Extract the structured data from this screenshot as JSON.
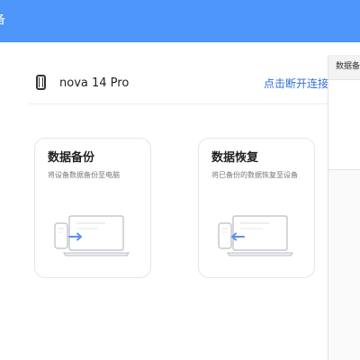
{
  "window": {
    "title": "备"
  },
  "device": {
    "icon": "phone-icon",
    "name": "nova 14 Pro",
    "disconnect_label": "点击断开连接"
  },
  "cards": {
    "backup": {
      "title": "数据备份",
      "description": "将设备数据备份至电脑",
      "illustration": "phone-to-computer-illustration"
    },
    "restore": {
      "title": "数据恢复",
      "description": "将已备份的数据恢复至设备",
      "illustration": "computer-to-phone-illustration"
    }
  },
  "side_panel": {
    "header": "数据备"
  },
  "colors": {
    "topbar": "#4e96f9",
    "link": "#2f6fd8",
    "arrow": "#5b8ff0"
  }
}
